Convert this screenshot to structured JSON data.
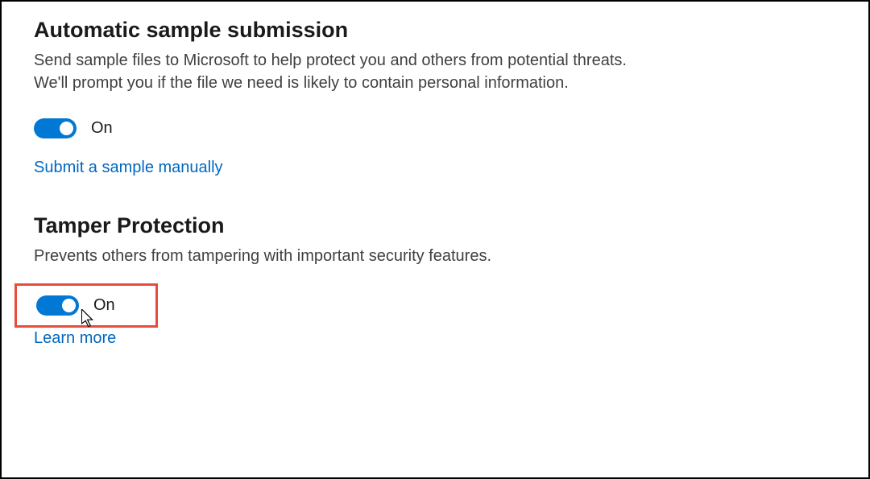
{
  "sections": {
    "sample_submission": {
      "title": "Automatic sample submission",
      "description": "Send sample files to Microsoft to help protect you and others from potential threats. We'll prompt you if the file we need is likely to contain personal information.",
      "toggle_state": "On",
      "link_text": "Submit a sample manually"
    },
    "tamper_protection": {
      "title": "Tamper Protection",
      "description": "Prevents others from tampering with important security features.",
      "toggle_state": "On",
      "link_text": "Learn more"
    }
  },
  "colors": {
    "accent": "#0078d4",
    "link": "#0067c0",
    "highlight": "#e74c3c"
  }
}
